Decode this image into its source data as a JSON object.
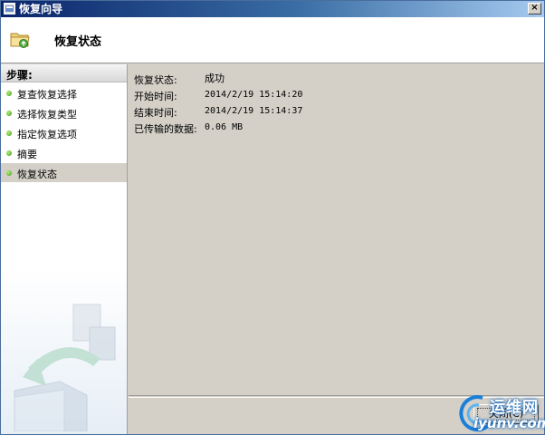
{
  "window": {
    "title": "恢复向导",
    "close_glyph": "×"
  },
  "header": {
    "title": "恢复状态",
    "icon": "folder-restore-icon"
  },
  "sidebar": {
    "heading": "步骤:",
    "steps": [
      {
        "label": "复查恢复选择",
        "active": false
      },
      {
        "label": "选择恢复类型",
        "active": false
      },
      {
        "label": "指定恢复选项",
        "active": false
      },
      {
        "label": "摘要",
        "active": false
      },
      {
        "label": "恢复状态",
        "active": true
      }
    ]
  },
  "details": [
    {
      "key": "恢复状态:",
      "value": "成功"
    },
    {
      "key": "开始时间:",
      "value": "2014/2/19 15:14:20"
    },
    {
      "key": "结束时间:",
      "value": "2014/2/19 15:14:37"
    },
    {
      "key": "已传输的数据:",
      "value": "0.06 MB"
    }
  ],
  "footer": {
    "close_label": "关闭(C)"
  },
  "watermark": {
    "text": "运维网",
    "url": "iyunv.com"
  },
  "colors": {
    "titlebar_start": "#0a246a",
    "titlebar_end": "#a6caf0",
    "panel": "#d4d0c8",
    "step_dot": "#3a9a1a"
  }
}
